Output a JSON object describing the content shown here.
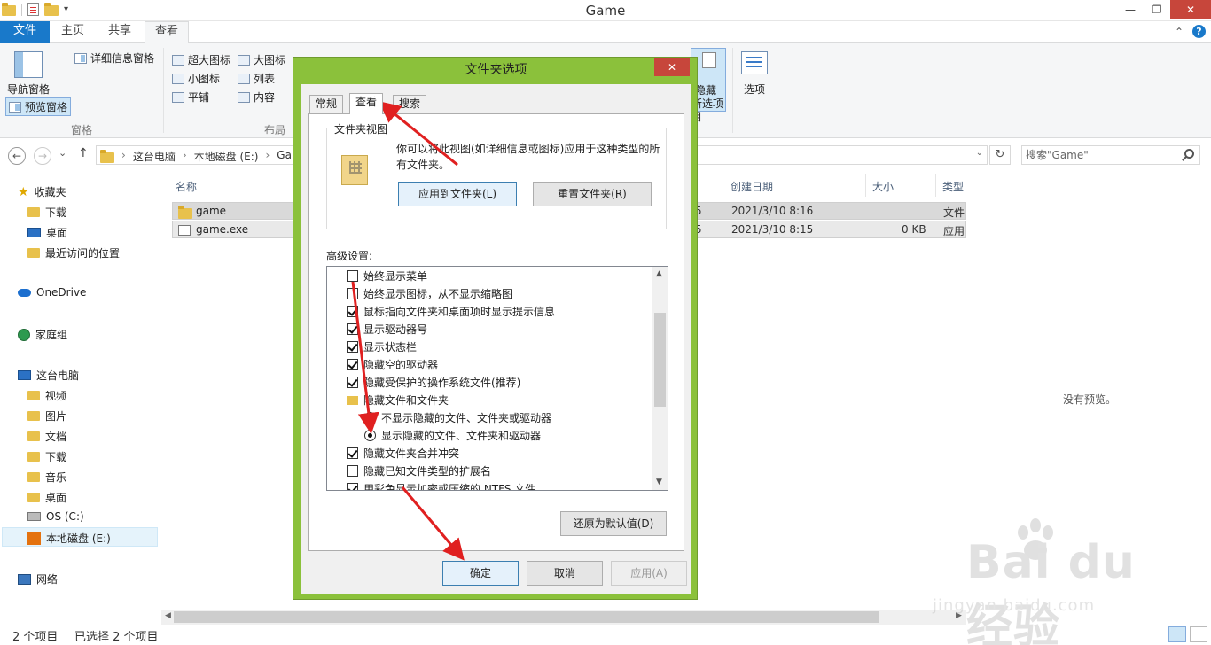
{
  "window": {
    "title": "Game",
    "minimize": "—",
    "restore": "❐",
    "close": "✕"
  },
  "ribbon": {
    "tabs": [
      {
        "label": "文件"
      },
      {
        "label": "主页"
      },
      {
        "label": "共享"
      },
      {
        "label": "查看"
      }
    ],
    "collapse": "⌃",
    "help": "?",
    "panes": {
      "nav_pane": "导航窗格",
      "preview_pane": "预览窗格",
      "details_pane": "详细信息窗格",
      "group_label": "窗格"
    },
    "layout": {
      "extra_large": "超大图标",
      "large": "大图标",
      "small": "小图标",
      "list": "列表",
      "tiles": "平铺",
      "content": "内容",
      "group_label": "布局"
    },
    "hide_selected": [
      "隐藏",
      "所选项目"
    ],
    "options": "选项"
  },
  "address": {
    "back": "←",
    "forward": "→",
    "recent": "⌄",
    "up": "↑",
    "crumbs": [
      "这台电脑",
      "本地磁盘 (E:)",
      "Ga"
    ],
    "dropdown": "⌄",
    "refresh": "↻",
    "search_placeholder": "搜索\"Game\""
  },
  "nav": {
    "favorites": "收藏夹",
    "downloads": "下载",
    "desktop": "桌面",
    "recent": "最近访问的位置",
    "onedrive": "OneDrive",
    "homegroup": "家庭组",
    "this_pc": "这台电脑",
    "videos": "视频",
    "pictures": "图片",
    "documents": "文档",
    "downloads2": "下载",
    "music": "音乐",
    "desktop2": "桌面",
    "os_c": "OS (C:)",
    "local_e": "本地磁盘 (E:)",
    "network": "网络"
  },
  "filelist": {
    "columns": {
      "name": "名称",
      "created": "创建日期",
      "size": "大小",
      "type": "类型"
    },
    "rows": [
      {
        "name": "game",
        "frag": "5",
        "created": "2021/3/10 8:16",
        "size": "",
        "type": "文件"
      },
      {
        "name": "game.exe",
        "frag": "5",
        "created": "2021/3/10 8:15",
        "size": "0 KB",
        "type": "应用"
      }
    ]
  },
  "preview": {
    "empty": "没有预览。"
  },
  "status": {
    "count": "2 个项目",
    "selected": "已选择 2 个项目"
  },
  "watermark": {
    "brand": "Bai du 经验",
    "url": "jingyan.baidu.com"
  },
  "dialog": {
    "title": "文件夹选项",
    "close": "✕",
    "tabs": [
      "常规",
      "查看",
      "搜索"
    ],
    "folder_views": {
      "label": "文件夹视图",
      "description": "你可以将此视图(如详细信息或图标)应用于这种类型的所有文件夹。",
      "apply": "应用到文件夹(L)",
      "reset": "重置文件夹(R)"
    },
    "advanced": {
      "label": "高级设置:",
      "items": [
        {
          "label": "始终显示菜单"
        },
        {
          "label": "始终显示图标，从不显示缩略图"
        },
        {
          "label": "鼠标指向文件夹和桌面项时显示提示信息"
        },
        {
          "label": "显示驱动器号"
        },
        {
          "label": "显示状态栏"
        },
        {
          "label": "隐藏空的驱动器"
        },
        {
          "label": "隐藏受保护的操作系统文件(推荐)"
        },
        {
          "label": "隐藏文件和文件夹"
        },
        {
          "label": "不显示隐藏的文件、文件夹或驱动器"
        },
        {
          "label": "显示隐藏的文件、文件夹和驱动器"
        },
        {
          "label": "隐藏文件夹合并冲突"
        },
        {
          "label": "隐藏已知文件类型的扩展名"
        },
        {
          "label": "用彩色显示加密或压缩的 NTFS 文件"
        }
      ]
    },
    "restore_defaults": "还原为默认值(D)",
    "ok": "确定",
    "cancel": "取消",
    "apply": "应用(A)"
  }
}
